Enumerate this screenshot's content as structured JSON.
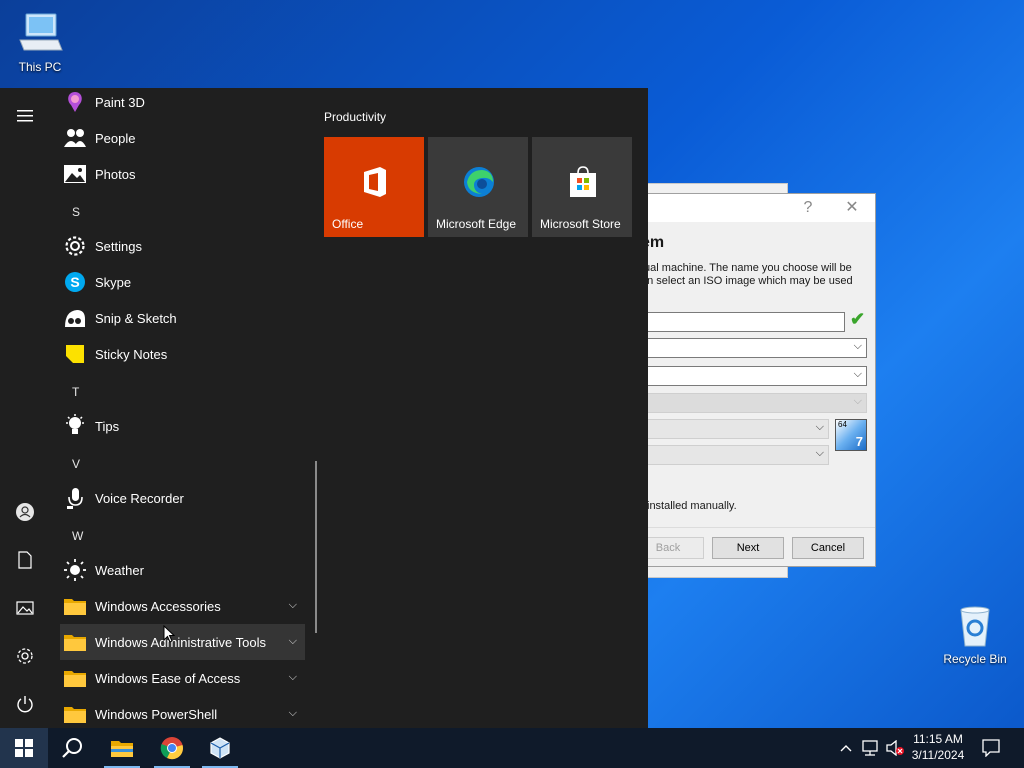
{
  "desktop": {
    "icons": [
      {
        "label": "This PC"
      },
      {
        "label": "Recycle Bin"
      }
    ]
  },
  "vbox_dialog": {
    "help_symbol": "?",
    "close_symbol": "✕",
    "heading": "em",
    "description_line1": "tual machine. The name you choose will be",
    "description_line2": "an select an ISO image which may be used",
    "os_badge_text": "64",
    "os_badge_num": "7",
    "note": "installed manually.",
    "back_label": "Back",
    "next_label": "Next",
    "cancel_label": "Cancel"
  },
  "start_menu": {
    "apps": [
      {
        "label": "Paint 3D",
        "icon": "paint3d-icon"
      },
      {
        "label": "People",
        "icon": "people-icon"
      },
      {
        "label": "Photos",
        "icon": "photos-icon"
      },
      {
        "letter": "S"
      },
      {
        "label": "Settings",
        "icon": "gear-icon"
      },
      {
        "label": "Skype",
        "icon": "skype-icon"
      },
      {
        "label": "Snip & Sketch",
        "icon": "snip-icon"
      },
      {
        "label": "Sticky Notes",
        "icon": "sticky-notes-icon"
      },
      {
        "letter": "T"
      },
      {
        "label": "Tips",
        "icon": "lightbulb-icon"
      },
      {
        "letter": "V"
      },
      {
        "label": "Voice Recorder",
        "icon": "microphone-icon"
      },
      {
        "letter": "W"
      },
      {
        "label": "Weather",
        "icon": "sun-icon"
      },
      {
        "label": "Windows Accessories",
        "icon": "folder-icon"
      },
      {
        "label": "Windows Administrative Tools",
        "icon": "folder-icon"
      },
      {
        "label": "Windows Ease of Access",
        "icon": "folder-icon"
      },
      {
        "label": "Windows PowerShell",
        "icon": "folder-icon"
      }
    ],
    "tiles_group_title": "Productivity",
    "tiles": [
      {
        "label": "Office",
        "color": "#d83b01"
      },
      {
        "label": "Microsoft Edge",
        "color": "#3a3a3a"
      },
      {
        "label": "Microsoft Store",
        "color": "#3a3a3a"
      }
    ]
  },
  "taskbar": {
    "time": "11:15 AM",
    "date": "3/11/2024"
  }
}
